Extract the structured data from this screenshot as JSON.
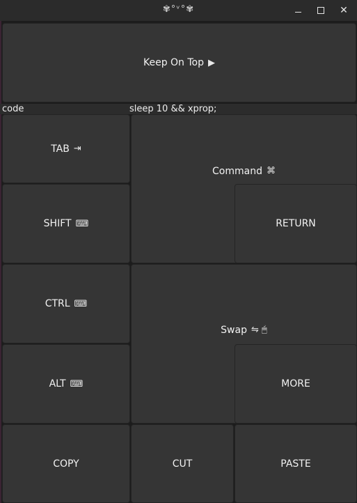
{
  "window": {
    "title": "✾°ᵛ°✾",
    "minimize_label": "–",
    "maximize_label": "☐",
    "close_label": "✕"
  },
  "keep_on_top": {
    "label": "Keep On Top",
    "glyph": "▶"
  },
  "command_bar": {
    "label": "code",
    "value": "sleep 10 && xprop;"
  },
  "keys": {
    "tab": {
      "label": "TAB",
      "glyph": "⇥"
    },
    "shift": {
      "label": "SHIFT",
      "glyph": "⌨"
    },
    "ctrl": {
      "label": "CTRL",
      "glyph": "⌨"
    },
    "alt": {
      "label": "ALT",
      "glyph": "⌨"
    },
    "command": {
      "label": "Command",
      "glyph": "⌘"
    },
    "return": {
      "label": "RETURN"
    },
    "swap": {
      "label": "Swap",
      "glyph": "⇋ 🖱"
    },
    "more": {
      "label": "MORE"
    },
    "copy": {
      "label": "COPY"
    },
    "cut": {
      "label": "CUT"
    },
    "paste": {
      "label": "PASTE"
    }
  }
}
